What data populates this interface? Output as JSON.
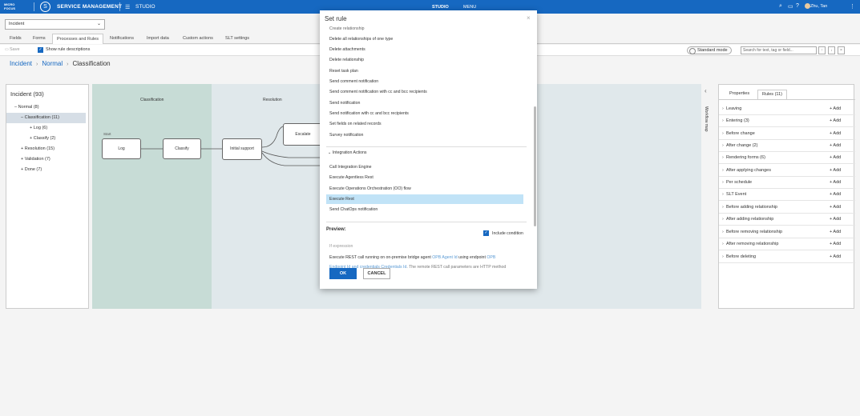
{
  "topbar": {
    "logo_line1": "MICRO",
    "logo_line2": "FOCUS",
    "product": "SERVICE MANAGEMENT",
    "studio": "STUDIO",
    "tabs": [
      {
        "label": "STUDIO",
        "active": true
      },
      {
        "label": "MENU",
        "active": false
      }
    ],
    "user": "Zhu, Tan"
  },
  "record_type": "Incident",
  "subtabs": [
    {
      "label": "Fields",
      "active": false
    },
    {
      "label": "Forms",
      "active": false
    },
    {
      "label": "Processes and Rules",
      "active": true
    },
    {
      "label": "Notifications",
      "active": false
    },
    {
      "label": "Import data",
      "active": false
    },
    {
      "label": "Custom actions",
      "active": false
    },
    {
      "label": "SLT settings",
      "active": false
    }
  ],
  "toolbar": {
    "save_label": "Save",
    "show_desc_label": "Show rule descriptions",
    "standard_mode": "Standard mode",
    "search_placeholder": "Search for text, tag or field..."
  },
  "breadcrumb": [
    "Incident",
    "Normal",
    "Classification"
  ],
  "left_panel": {
    "title": "Incident (93)",
    "tree": [
      {
        "label": "Normal (8)",
        "prefix": "–",
        "indent": 1,
        "selected": false
      },
      {
        "label": "Classification (11)",
        "prefix": "–",
        "indent": 2,
        "selected": true
      },
      {
        "label": "Log (6)",
        "prefix": "+",
        "indent": 3,
        "selected": false
      },
      {
        "label": "Classify (2)",
        "prefix": "+",
        "indent": 3,
        "selected": false
      },
      {
        "label": "Resolution (15)",
        "prefix": "+",
        "indent": 2,
        "selected": false
      },
      {
        "label": "Validation (7)",
        "prefix": "+",
        "indent": 2,
        "selected": false
      },
      {
        "label": "Done (7)",
        "prefix": "+",
        "indent": 2,
        "selected": false
      }
    ]
  },
  "canvas": {
    "lanes": [
      "Classification",
      "Resolution"
    ],
    "start_label": "Start",
    "nodes": [
      "Log",
      "Classify",
      "Initial support",
      "Escalate"
    ]
  },
  "workflow_map_label": "Workflow map",
  "right_panel": {
    "tabs": [
      {
        "label": "Properties",
        "active": false
      },
      {
        "label": "Rules (11)",
        "active": true
      }
    ],
    "add_label": "+ Add",
    "rules": [
      "Leaving",
      "Entering (3)",
      "Before change",
      "After change (2)",
      "Rendering forms (6)",
      "After applying changes",
      "Per schedule",
      "SLT Event",
      "Before adding relationship",
      "After adding relationship",
      "Before removing relationship",
      "After removing relationship",
      "Before deleting"
    ]
  },
  "modal": {
    "title": "Set rule",
    "items_top": [
      "Create relationship",
      "Delete all relationships of one type",
      "Delete attachments",
      "Delete relationship",
      "Reset task plan",
      "Send comment notification",
      "Send comment notification with cc and bcc recipients",
      "Send notification",
      "Send notification with cc and bcc recipients",
      "Set fields on related records",
      "Survey notification"
    ],
    "group_label": "Integration Actions",
    "items_integration": [
      {
        "label": "Call Integration Engine",
        "selected": false
      },
      {
        "label": "Execute Agentless Rest",
        "selected": false
      },
      {
        "label": "Execute Operations Orchestration (OO) flow",
        "selected": false
      },
      {
        "label": "Execute Rest",
        "selected": true
      },
      {
        "label": "Send ChatOps notification",
        "selected": false
      }
    ],
    "preview_label": "Preview:",
    "include_condition": "Include condition",
    "preview_if": "If expression",
    "preview_line1_a": "Execute REST call running on on-premise bridge agent",
    "preview_line1_b": "OPB Agent Id",
    "preview_line1_c": "using endpoint",
    "preview_line1_d": "OPB",
    "preview_line2_a": "Endpoint Id and credentials",
    "preview_line2_b": "Credentials Id",
    "preview_line2_c": ". The remote REST call parameters are HTTP method",
    "ok": "OK",
    "cancel": "CANCEL"
  }
}
